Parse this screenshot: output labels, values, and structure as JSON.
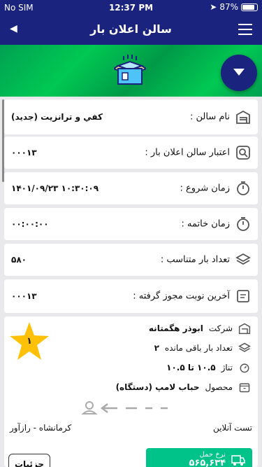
{
  "status": {
    "carrier": "No SIM",
    "time": "12:37 PM",
    "battery": "87%",
    "battery_level": 0.87
  },
  "nav": {
    "title": "سالن اعلان بار"
  },
  "info": [
    {
      "label": "نام سالن :",
      "value": "كفي و ترانزيت (جديد)",
      "icon": "warehouse-icon"
    },
    {
      "label": "اعتبار سالن اعلان بار :",
      "value": "۰۰۰۱۳",
      "icon": "search-icon"
    },
    {
      "label": "زمان شروع :",
      "value": "۱۴۰۱/۰۹/۲۳ ۱۰:۳۰:۰۹",
      "icon": "stopwatch-icon"
    },
    {
      "label": "زمان خاتمه :",
      "value": "۰۰:۰۰:۰۰",
      "icon": "stopwatch-icon"
    },
    {
      "label": "تعداد بار متناسب :",
      "value": "۵۸۰",
      "icon": "layers-icon"
    },
    {
      "label": "آخرین نوبت مجوز گرفته :",
      "value": "۰۰۰۱۳",
      "icon": "document-icon"
    }
  ],
  "item": {
    "rank": "۱",
    "company_label": "شرکت",
    "company_value": "ابوذر هگمتانه",
    "remaining_label": "تعداد بار باقی مانده",
    "remaining_value": "۲",
    "tonnage_label": "تناژ",
    "tonnage_value": "۱۰.۵ تا ۱۰.۵",
    "product_label": "محصول",
    "product_value": "حباب لامپ (دستگاه)",
    "online_text": "تست آنلاین",
    "location_text": "کرمانشاه - رازآور",
    "freight_label": "نرخ حمل",
    "freight_value": "۵۶۵,۶۳۴",
    "details_label": "جزئیات"
  },
  "colors": {
    "primary": "#1a237e",
    "banner_green": "#00c853",
    "button_green": "#00c389",
    "star": "#ffc107"
  }
}
